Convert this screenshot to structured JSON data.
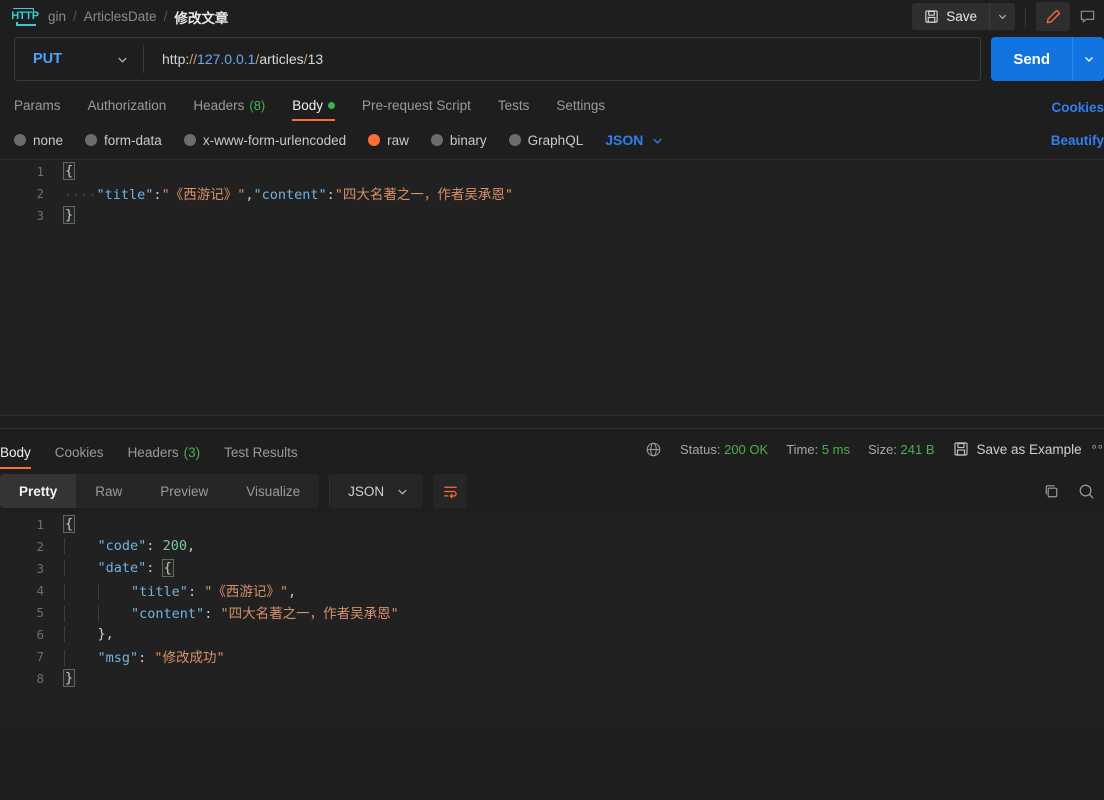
{
  "topbar": {
    "app_icon": "http-icon",
    "breadcrumb": [
      {
        "label": "gin",
        "active": false
      },
      {
        "label": "ArticlesDate",
        "active": false
      },
      {
        "label": "修改文章",
        "active": true
      }
    ],
    "separator": "/",
    "save_label": "Save",
    "save_icon": "floppy-disk-icon",
    "save_caret_icon": "chevron-down-icon",
    "edit_icon": "pencil-icon",
    "comment_icon": "comment-icon",
    "accent_color": "#ff6c37"
  },
  "request": {
    "method": "PUT",
    "method_caret_icon": "chevron-down-icon",
    "url": "http://127.0.0.1/articles/13",
    "url_parts": {
      "scheme": "http:",
      "slashes": "//",
      "host": "127.0.0.1",
      "path_sep1": "/",
      "path1": "articles",
      "path_sep2": "/",
      "path2": "13"
    },
    "send_label": "Send",
    "send_caret_icon": "chevron-down-icon",
    "send_color": "#1274e0",
    "tabs": [
      {
        "label": "Params",
        "active": false,
        "count": "",
        "dot": false
      },
      {
        "label": "Authorization",
        "active": false,
        "count": "",
        "dot": false
      },
      {
        "label": "Headers",
        "active": false,
        "count": "(8)",
        "dot": false
      },
      {
        "label": "Body",
        "active": true,
        "count": "",
        "dot": true
      },
      {
        "label": "Pre-request Script",
        "active": false,
        "count": "",
        "dot": false
      },
      {
        "label": "Tests",
        "active": false,
        "count": "",
        "dot": false
      },
      {
        "label": "Settings",
        "active": false,
        "count": "",
        "dot": false
      }
    ],
    "cookies_link": "Cookies",
    "body_types": [
      {
        "label": "none",
        "selected": false
      },
      {
        "label": "form-data",
        "selected": false
      },
      {
        "label": "x-www-form-urlencoded",
        "selected": false
      },
      {
        "label": "raw",
        "selected": true
      },
      {
        "label": "binary",
        "selected": false
      },
      {
        "label": "GraphQL",
        "selected": false
      }
    ],
    "body_format": "JSON",
    "body_format_caret_icon": "chevron-down-icon",
    "beautify_link": "Beautify",
    "body_lines": [
      {
        "num": "1",
        "text": "{"
      },
      {
        "num": "2",
        "text": "    \"title\":\"《西游记》\",\"content\":\"四大名著之一，作者吴承恩\""
      },
      {
        "num": "3",
        "text": "}"
      }
    ],
    "body_raw": "{\n    \"title\":\"《西游记》\",\"content\":\"四大名著之一，作者吴承恩\"\n}"
  },
  "response": {
    "tabs": [
      {
        "label": "Body",
        "active": true,
        "count": ""
      },
      {
        "label": "Cookies",
        "active": false,
        "count": ""
      },
      {
        "label": "Headers",
        "active": false,
        "count": "(3)"
      },
      {
        "label": "Test Results",
        "active": false,
        "count": ""
      }
    ],
    "globe_icon": "globe-icon",
    "status_label": "Status:",
    "status_value": "200 OK",
    "time_label": "Time:",
    "time_value": "5 ms",
    "size_label": "Size:",
    "size_value": "241 B",
    "save_example_icon": "floppy-disk-icon",
    "save_example_label": "Save as Example",
    "more_icon": "ellipsis-icon",
    "status_color": "#4caf50",
    "view_tabs": [
      {
        "label": "Pretty",
        "active": true
      },
      {
        "label": "Raw",
        "active": false
      },
      {
        "label": "Preview",
        "active": false
      },
      {
        "label": "Visualize",
        "active": false
      }
    ],
    "format": "JSON",
    "format_caret_icon": "chevron-down-icon",
    "wrap_icon": "wrap-lines-icon",
    "copy_icon": "copy-icon",
    "search_icon": "search-icon",
    "body_lines": [
      {
        "num": "1",
        "text": "{"
      },
      {
        "num": "2",
        "key": "\"code\"",
        "value": "200",
        "value_type": "number",
        "trail": ","
      },
      {
        "num": "3",
        "key": "\"date\"",
        "value": "{",
        "value_type": "punct",
        "trail": ""
      },
      {
        "num": "4",
        "key": "\"title\"",
        "value": "\"《西游记》\"",
        "value_type": "string",
        "trail": ","
      },
      {
        "num": "5",
        "key": "\"content\"",
        "value": "\"四大名著之一，作者吴承恩\"",
        "value_type": "string",
        "trail": ""
      },
      {
        "num": "6",
        "text": "},"
      },
      {
        "num": "7",
        "key": "\"msg\"",
        "value": "\"修改成功\"",
        "value_type": "string",
        "trail": ""
      },
      {
        "num": "8",
        "text": "}"
      }
    ],
    "body_raw": "{\n    \"code\": 200,\n    \"date\": {\n        \"title\": \"《西游记》\",\n        \"content\": \"四大名著之一，作者吴承恩\"\n    },\n    \"msg\": \"修改成功\"\n}"
  }
}
